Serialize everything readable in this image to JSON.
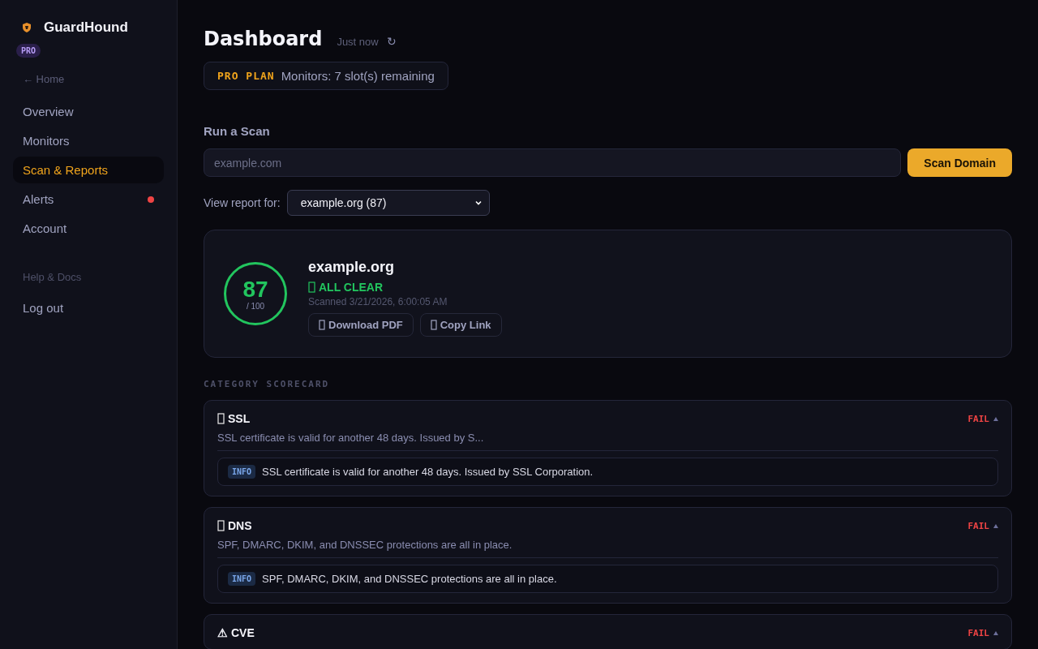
{
  "sidebar": {
    "brand": "GuardHound",
    "badge": "PRO",
    "home_link": "← Home",
    "items": [
      {
        "label": "Overview",
        "selected": false,
        "alert": false
      },
      {
        "label": "Monitors",
        "selected": false,
        "alert": false
      },
      {
        "label": "Scan & Reports",
        "selected": true,
        "alert": false
      },
      {
        "label": "Alerts",
        "selected": false,
        "alert": true
      },
      {
        "label": "Account",
        "selected": false,
        "alert": false
      }
    ],
    "help": "Help & Docs",
    "logout": "Log out"
  },
  "header": {
    "title": "Dashboard",
    "updated": "Just now",
    "refresh": "↻"
  },
  "plan": {
    "name": "PRO PLAN",
    "text": "Monitors: 7 slot(s) remaining"
  },
  "scan": {
    "title": "Run a Scan",
    "placeholder": "example.com",
    "button": "Scan Domain"
  },
  "report_select": {
    "label": "View report for:",
    "value": "example.org (87)"
  },
  "report": {
    "score": "87",
    "out_of": "/ 100",
    "domain": "example.org",
    "status": "ALL CLEAR",
    "scanned": "Scanned 3/21/2026, 6:00:05 AM",
    "actions": [
      "Download PDF",
      "Copy Link"
    ]
  },
  "scorecard_title": "CATEGORY SCORECARD",
  "categories": [
    {
      "kind": "glyph",
      "title": "SSL",
      "summary": "SSL certificate is valid for another 48 days. Issued by S...",
      "result": "FAIL",
      "expanded": true,
      "findings": [
        {
          "level": "INFO",
          "text": "SSL certificate is valid for another 48 days. Issued by SSL Corporation."
        }
      ]
    },
    {
      "kind": "glyph",
      "title": "DNS",
      "summary": "SPF, DMARC, DKIM, and DNSSEC protections are all in place.",
      "result": "FAIL",
      "expanded": true,
      "findings": [
        {
          "level": "INFO",
          "text": "SPF, DMARC, DKIM, and DNSSEC protections are all in place."
        }
      ]
    },
    {
      "kind": "warning",
      "icon": "⚠",
      "title": "CVE",
      "result": "FAIL",
      "expanded": true
    }
  ]
}
